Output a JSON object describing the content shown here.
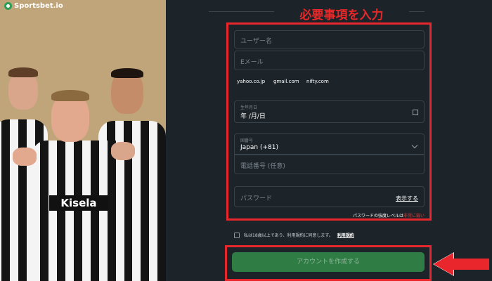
{
  "brand": {
    "name": "Sportsbet.io"
  },
  "hero": {
    "sponsor": "Kisela"
  },
  "annotation": {
    "heading": "必要事項を入力"
  },
  "form": {
    "username_placeholder": "ユーザー名",
    "email_placeholder": "Eメール",
    "email_domains": [
      "yahoo.co.jp",
      "gmail.com",
      "nifty.com"
    ],
    "dob_label": "生年月日",
    "dob_value": "年 /月/日",
    "country_label": "国番号",
    "country_value": "Japan (+81)",
    "phone_placeholder": "電話番号 (任意)",
    "password_placeholder": "パスワード",
    "show_password": "表示する",
    "strength_label": "パスワードの強度レベルは",
    "strength_value": "非常に弱い",
    "terms_text": "私は18歳以上であり、利用規約に同意します。",
    "terms_link": "利用規約",
    "submit_label": "アカウントを作成する"
  },
  "colors": {
    "accent_red": "#e8262b",
    "button_green": "#2f7c45",
    "background": "#1c2329",
    "hero_gold": "#c1a57a"
  }
}
